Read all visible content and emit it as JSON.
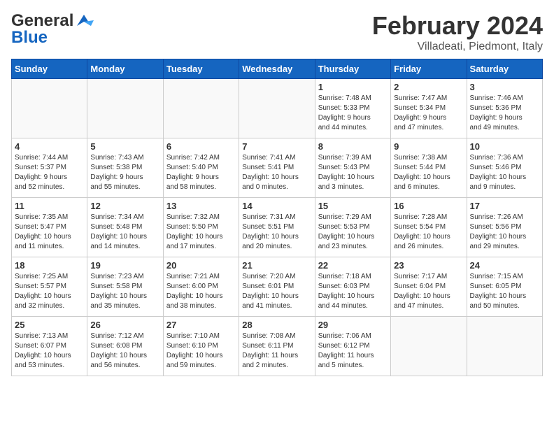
{
  "header": {
    "logo_general": "General",
    "logo_blue": "Blue",
    "month_title": "February 2024",
    "location": "Villadeati, Piedmont, Italy"
  },
  "weekdays": [
    "Sunday",
    "Monday",
    "Tuesday",
    "Wednesday",
    "Thursday",
    "Friday",
    "Saturday"
  ],
  "weeks": [
    [
      {
        "day": "",
        "info": ""
      },
      {
        "day": "",
        "info": ""
      },
      {
        "day": "",
        "info": ""
      },
      {
        "day": "",
        "info": ""
      },
      {
        "day": "1",
        "info": "Sunrise: 7:48 AM\nSunset: 5:33 PM\nDaylight: 9 hours\nand 44 minutes."
      },
      {
        "day": "2",
        "info": "Sunrise: 7:47 AM\nSunset: 5:34 PM\nDaylight: 9 hours\nand 47 minutes."
      },
      {
        "day": "3",
        "info": "Sunrise: 7:46 AM\nSunset: 5:36 PM\nDaylight: 9 hours\nand 49 minutes."
      }
    ],
    [
      {
        "day": "4",
        "info": "Sunrise: 7:44 AM\nSunset: 5:37 PM\nDaylight: 9 hours\nand 52 minutes."
      },
      {
        "day": "5",
        "info": "Sunrise: 7:43 AM\nSunset: 5:38 PM\nDaylight: 9 hours\nand 55 minutes."
      },
      {
        "day": "6",
        "info": "Sunrise: 7:42 AM\nSunset: 5:40 PM\nDaylight: 9 hours\nand 58 minutes."
      },
      {
        "day": "7",
        "info": "Sunrise: 7:41 AM\nSunset: 5:41 PM\nDaylight: 10 hours\nand 0 minutes."
      },
      {
        "day": "8",
        "info": "Sunrise: 7:39 AM\nSunset: 5:43 PM\nDaylight: 10 hours\nand 3 minutes."
      },
      {
        "day": "9",
        "info": "Sunrise: 7:38 AM\nSunset: 5:44 PM\nDaylight: 10 hours\nand 6 minutes."
      },
      {
        "day": "10",
        "info": "Sunrise: 7:36 AM\nSunset: 5:46 PM\nDaylight: 10 hours\nand 9 minutes."
      }
    ],
    [
      {
        "day": "11",
        "info": "Sunrise: 7:35 AM\nSunset: 5:47 PM\nDaylight: 10 hours\nand 11 minutes."
      },
      {
        "day": "12",
        "info": "Sunrise: 7:34 AM\nSunset: 5:48 PM\nDaylight: 10 hours\nand 14 minutes."
      },
      {
        "day": "13",
        "info": "Sunrise: 7:32 AM\nSunset: 5:50 PM\nDaylight: 10 hours\nand 17 minutes."
      },
      {
        "day": "14",
        "info": "Sunrise: 7:31 AM\nSunset: 5:51 PM\nDaylight: 10 hours\nand 20 minutes."
      },
      {
        "day": "15",
        "info": "Sunrise: 7:29 AM\nSunset: 5:53 PM\nDaylight: 10 hours\nand 23 minutes."
      },
      {
        "day": "16",
        "info": "Sunrise: 7:28 AM\nSunset: 5:54 PM\nDaylight: 10 hours\nand 26 minutes."
      },
      {
        "day": "17",
        "info": "Sunrise: 7:26 AM\nSunset: 5:56 PM\nDaylight: 10 hours\nand 29 minutes."
      }
    ],
    [
      {
        "day": "18",
        "info": "Sunrise: 7:25 AM\nSunset: 5:57 PM\nDaylight: 10 hours\nand 32 minutes."
      },
      {
        "day": "19",
        "info": "Sunrise: 7:23 AM\nSunset: 5:58 PM\nDaylight: 10 hours\nand 35 minutes."
      },
      {
        "day": "20",
        "info": "Sunrise: 7:21 AM\nSunset: 6:00 PM\nDaylight: 10 hours\nand 38 minutes."
      },
      {
        "day": "21",
        "info": "Sunrise: 7:20 AM\nSunset: 6:01 PM\nDaylight: 10 hours\nand 41 minutes."
      },
      {
        "day": "22",
        "info": "Sunrise: 7:18 AM\nSunset: 6:03 PM\nDaylight: 10 hours\nand 44 minutes."
      },
      {
        "day": "23",
        "info": "Sunrise: 7:17 AM\nSunset: 6:04 PM\nDaylight: 10 hours\nand 47 minutes."
      },
      {
        "day": "24",
        "info": "Sunrise: 7:15 AM\nSunset: 6:05 PM\nDaylight: 10 hours\nand 50 minutes."
      }
    ],
    [
      {
        "day": "25",
        "info": "Sunrise: 7:13 AM\nSunset: 6:07 PM\nDaylight: 10 hours\nand 53 minutes."
      },
      {
        "day": "26",
        "info": "Sunrise: 7:12 AM\nSunset: 6:08 PM\nDaylight: 10 hours\nand 56 minutes."
      },
      {
        "day": "27",
        "info": "Sunrise: 7:10 AM\nSunset: 6:10 PM\nDaylight: 10 hours\nand 59 minutes."
      },
      {
        "day": "28",
        "info": "Sunrise: 7:08 AM\nSunset: 6:11 PM\nDaylight: 11 hours\nand 2 minutes."
      },
      {
        "day": "29",
        "info": "Sunrise: 7:06 AM\nSunset: 6:12 PM\nDaylight: 11 hours\nand 5 minutes."
      },
      {
        "day": "",
        "info": ""
      },
      {
        "day": "",
        "info": ""
      }
    ]
  ]
}
